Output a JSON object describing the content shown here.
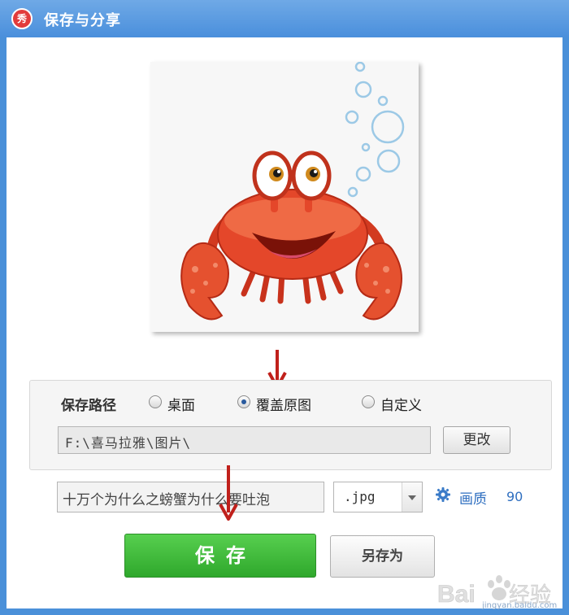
{
  "window": {
    "title": "保存与分享",
    "icon_char": "秀",
    "icon_name": "meitu-xiuxiu-icon"
  },
  "save_path": {
    "label": "保存路径",
    "options": [
      {
        "label": "桌面",
        "checked": false
      },
      {
        "label": "覆盖原图",
        "checked": true
      },
      {
        "label": "自定义",
        "checked": false
      }
    ],
    "path_value": "F:\\喜马拉雅\\图片\\",
    "change_button": "更改"
  },
  "file": {
    "name_value": "十万个为什么之螃蟹为什么要吐泡",
    "format_value": ".jpg",
    "quality_label": "画质",
    "quality_value": "90"
  },
  "actions": {
    "save_label": "保存",
    "save_as_label": "另存为"
  },
  "watermark": {
    "brand": "Baidu经验",
    "url": "jingyan.baidu.com"
  },
  "colors": {
    "title_bar": "#4a8fdc",
    "save_button": "#3cb838",
    "annotation_arrow": "#c0201b",
    "link_blue": "#2f6fc0"
  }
}
